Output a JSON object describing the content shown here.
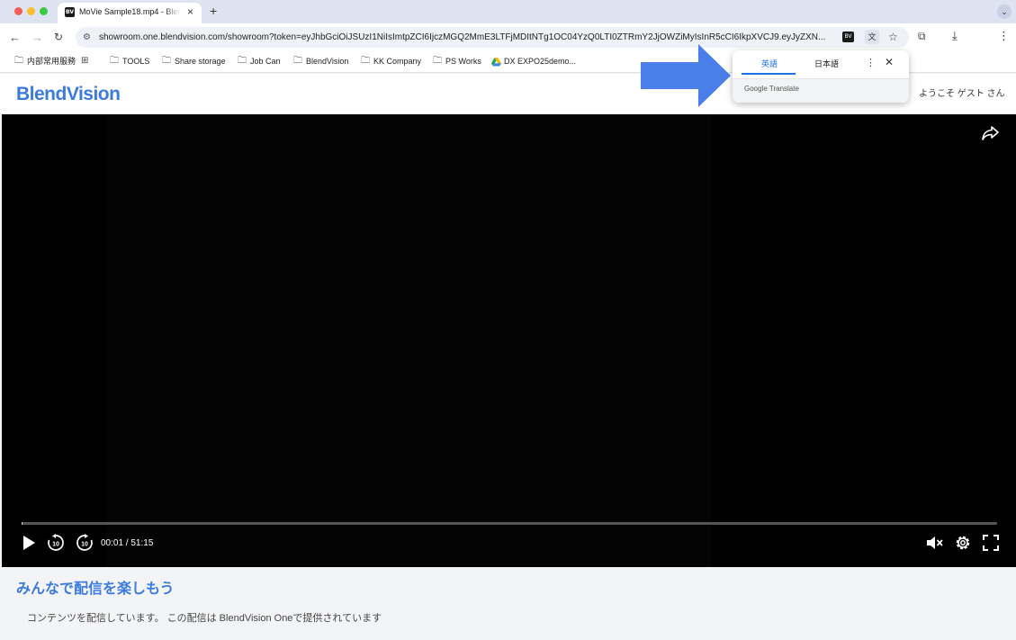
{
  "browser": {
    "tab_title": "MoVie Sample18.mp4 - BlendVision",
    "tab_favicon": "BV",
    "new_tab": "+",
    "url": "showroom.one.blendvision.com/showroom?token=eyJhbGciOiJSUzI1NiIsImtpZCI6IjczMGQ2MmE3LTFjMDItNTg1OC04YzQ0LTI0ZTRmY2JjOWZiMyIsInR5cCI6IkpXVCJ9.eyJyZXN...",
    "url_extension_badge": "BV",
    "bookmarks": [
      {
        "label": "内部常用服務",
        "icon": "folder-icon"
      },
      {
        "label": "",
        "icon": "apps-grid-icon"
      },
      {
        "label": "TOOLS",
        "icon": "folder-icon"
      },
      {
        "label": "Share storage",
        "icon": "folder-icon"
      },
      {
        "label": "Job Can",
        "icon": "folder-icon"
      },
      {
        "label": "BlendVision",
        "icon": "folder-icon"
      },
      {
        "label": "KK Company",
        "icon": "folder-icon"
      },
      {
        "label": "PS Works",
        "icon": "folder-icon"
      },
      {
        "label": "DX EXPO25demo...",
        "icon": "google-drive-icon"
      }
    ]
  },
  "translate_popup": {
    "tab_source": "英語",
    "tab_target": "日本語",
    "brand": "Google Translate"
  },
  "page": {
    "brand": "BlendVision",
    "welcome": "ようこそ ゲスト さん",
    "accent_color": "#3b7be0"
  },
  "player": {
    "current_time": "00:01",
    "duration": "51:15",
    "time_display": "00:01 / 51:15",
    "progress_fraction": 0.0003,
    "muted": true
  },
  "promo": {
    "title": "みんなで配信を楽しもう",
    "description": "コンテンツを配信しています。 この配信は BlendVision Oneで提供されています"
  }
}
